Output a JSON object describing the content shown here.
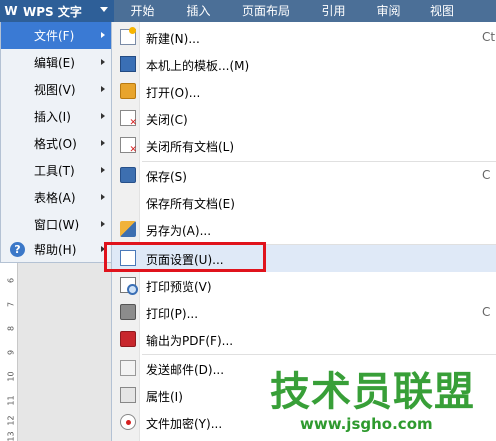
{
  "app": {
    "title": "WPS 文字",
    "logo": "W"
  },
  "ribbon_tabs": [
    "开始",
    "插入",
    "页面布局",
    "引用",
    "审阅",
    "视图"
  ],
  "main_menu": [
    {
      "label": "文件(F)",
      "active": true
    },
    {
      "label": "编辑(E)"
    },
    {
      "label": "视图(V)"
    },
    {
      "label": "插入(I)"
    },
    {
      "label": "格式(O)"
    },
    {
      "label": "工具(T)"
    },
    {
      "label": "表格(A)"
    },
    {
      "label": "窗口(W)"
    },
    {
      "label": "帮助(H)",
      "icon": "help-icon",
      "icon_glyph": "?"
    }
  ],
  "file_menu": {
    "items": [
      {
        "label": "新建(N)...",
        "icon": "new-document-icon",
        "shortcut": "Ctrl"
      },
      {
        "label": "本机上的模板...(M)",
        "icon": "template-icon"
      },
      {
        "label": "打开(O)...",
        "icon": "open-folder-icon"
      },
      {
        "label": "关闭(C)",
        "icon": "close-document-icon"
      },
      {
        "label": "关闭所有文档(L)",
        "icon": "close-all-icon"
      },
      {
        "label": "保存(S)",
        "icon": "save-icon",
        "shortcut": "C"
      },
      {
        "label": "保存所有文档(E)",
        "icon": ""
      },
      {
        "label": "另存为(A)...",
        "icon": "save-as-icon"
      },
      {
        "label": "页面设置(U)...",
        "icon": "page-setup-icon",
        "highlighted": true
      },
      {
        "label": "打印预览(V)",
        "icon": "print-preview-icon"
      },
      {
        "label": "打印(P)...",
        "icon": "print-icon",
        "shortcut": "C"
      },
      {
        "label": "输出为PDF(F)...",
        "icon": "export-pdf-icon"
      },
      {
        "label": "发送邮件(D)...",
        "icon": "send-mail-icon"
      },
      {
        "label": "属性(I)",
        "icon": "properties-icon"
      },
      {
        "label": "文件加密(Y)...",
        "icon": "encrypt-file-icon"
      }
    ]
  },
  "ruler_numbers": [
    "6",
    "7",
    "8",
    "9",
    "10",
    "11",
    "12",
    "13"
  ],
  "watermark": {
    "text": "技术员联盟",
    "url": "www.jsgho.com"
  },
  "colors": {
    "ribbon": "#4b6f97",
    "wps_button": "#2e5f98",
    "menu_active": "#3a7ad4",
    "highlight_box": "#e0131c",
    "watermark": "#2e9a2e"
  }
}
